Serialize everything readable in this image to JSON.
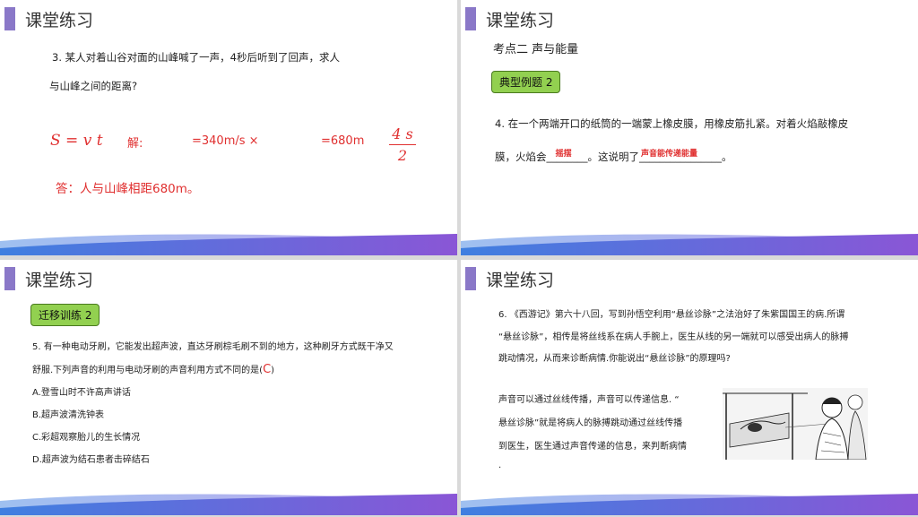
{
  "slide_title": "课堂练习",
  "s1": {
    "q_line1": "3. 某人对着山谷对面的山峰喊了一声，4秒后听到了回声，求人",
    "q_line2": "与山峰之间的距离?",
    "formula": "S  =  v t",
    "jie": "解:",
    "speed": "=340m/s ×",
    "result": "=680m",
    "frac_num": "4 s",
    "frac_den": "2",
    "answer": "答：人与山峰相距680m。"
  },
  "s2": {
    "kaodian": "考点二  声与能量",
    "box": "典型例题 2",
    "q_line1": "4. 在一个两端开口的纸筒的一端蒙上橡皮膜，用橡皮筋扎紧。对着火焰敲橡皮",
    "q_line2_a": "膜，火焰会",
    "blank1": "________",
    "ans1": "摇摆",
    "q_line2_b": "。这说明了",
    "blank2": "________________",
    "ans2": "声音能传递能量",
    "q_line2_c": "。"
  },
  "s3": {
    "box": "迁移训练 2",
    "q_line1": "5. 有一种电动牙刷，它能发出超声波，直达牙刷棕毛刷不到的地方，这种刷牙方式既干净又",
    "q_line2": "舒服.下列声音的利用与电动牙刷的声音利用方式不同的是(",
    "ans": "C",
    "q_close": ")",
    "optA": "A.登雪山时不许高声讲话",
    "optB": "B.超声波清洗钟表",
    "optC": "C.彩超观察胎儿的生长情况",
    "optD": "D.超声波为结石患者击碎结石"
  },
  "s4": {
    "q_line1": "6. 《西游记》第六十八回，写到孙悟空利用“悬丝诊脉”之法治好了朱紫国国王的病.所谓",
    "q_line2": "“悬丝诊脉”，相传是将丝线系在病人手腕上，医生从线的另一端就可以感受出病人的脉搏",
    "q_line3": "跳动情况，从而来诊断病情.你能说出“悬丝诊脉”的原理吗?",
    "a_line1": "声音可以通过丝线传播，声音可以传递信息.  “",
    "a_line2": "悬丝诊脉”就是将病人的脉搏跳动通过丝线传播",
    "a_line3": "到医生，医生通过声音传递的信息，来判断病情",
    "a_line4": "."
  },
  "colors": {
    "accent": "#8a78c8",
    "wave_blue": "#3f7fe0",
    "wave_purple": "#8a56d6",
    "answer_red": "#e03030",
    "box_green": "#92d050"
  }
}
